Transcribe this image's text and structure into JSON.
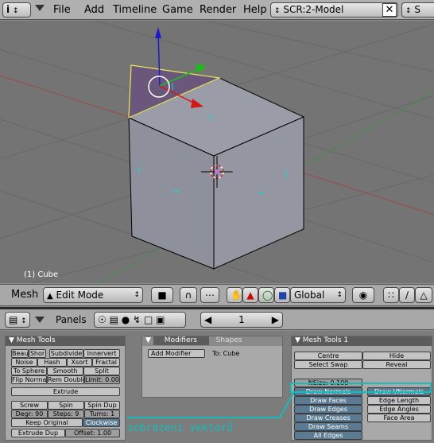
{
  "menubar": {
    "menus": [
      "File",
      "Add",
      "Timeline",
      "Game",
      "Render",
      "Help"
    ],
    "screen_selector": "SCR:2-Model",
    "scene_selector_partial": "S"
  },
  "viewport": {
    "object_label": "(1) Cube"
  },
  "view_toolbar": {
    "menu_label": "Mesh",
    "mode_select": "Edit Mode",
    "orientation_select": "Global"
  },
  "buttons_header": {
    "panels_label": "Panels",
    "frame_number": "1"
  },
  "mesh_tools": {
    "title": "Mesh Tools",
    "rows": [
      [
        "Beaut",
        "Shor",
        "Subdivide",
        "Innervert"
      ],
      [
        "Noise",
        "Hash",
        "Xsort",
        "Fractal"
      ],
      [
        "To Sphere",
        "Smooth",
        "Split"
      ],
      [
        "Flip Normal",
        "Rem Double",
        "Limit: 0.001"
      ]
    ],
    "extrude": "Extrude",
    "screw": "Screw",
    "spin": "Spin",
    "spin_dup": "Spin Dup",
    "degr": "Degr: 90",
    "steps": "Steps: 9",
    "turns": "Turns: 1",
    "keep_original": "Keep Original",
    "clockwise": "Clockwise",
    "extrude_dup": "Extrude Dup",
    "offset": "Offset: 1.00"
  },
  "modifiers": {
    "tab_modifiers": "Modifiers",
    "tab_shapes": "Shapes",
    "add_modifier": "Add Modifier",
    "to_label": "To: Cube"
  },
  "mesh_tools_1": {
    "title": "Mesh Tools 1",
    "centre": "Centre",
    "hide": "Hide",
    "select_swap": "Select Swap",
    "reveal": "Reveal",
    "nsize": "NSize: 0.100",
    "draw_normals": "Draw Normals",
    "draw_vnormals": "Draw VNormals",
    "draw_faces": "Draw Faces",
    "edge_length": "Edge Length",
    "draw_edges": "Draw Edges",
    "edge_angles": "Edge Angles",
    "draw_creases": "Draw Creases",
    "face_area": "Face Area",
    "draw_seams": "Draw Seams",
    "all_edges": "All Edges"
  },
  "annotation": {
    "text": "zobrazení vektorů"
  },
  "colors": {
    "accent_cyan": "#14bcbc",
    "active_toggle": "#5b7b92"
  }
}
